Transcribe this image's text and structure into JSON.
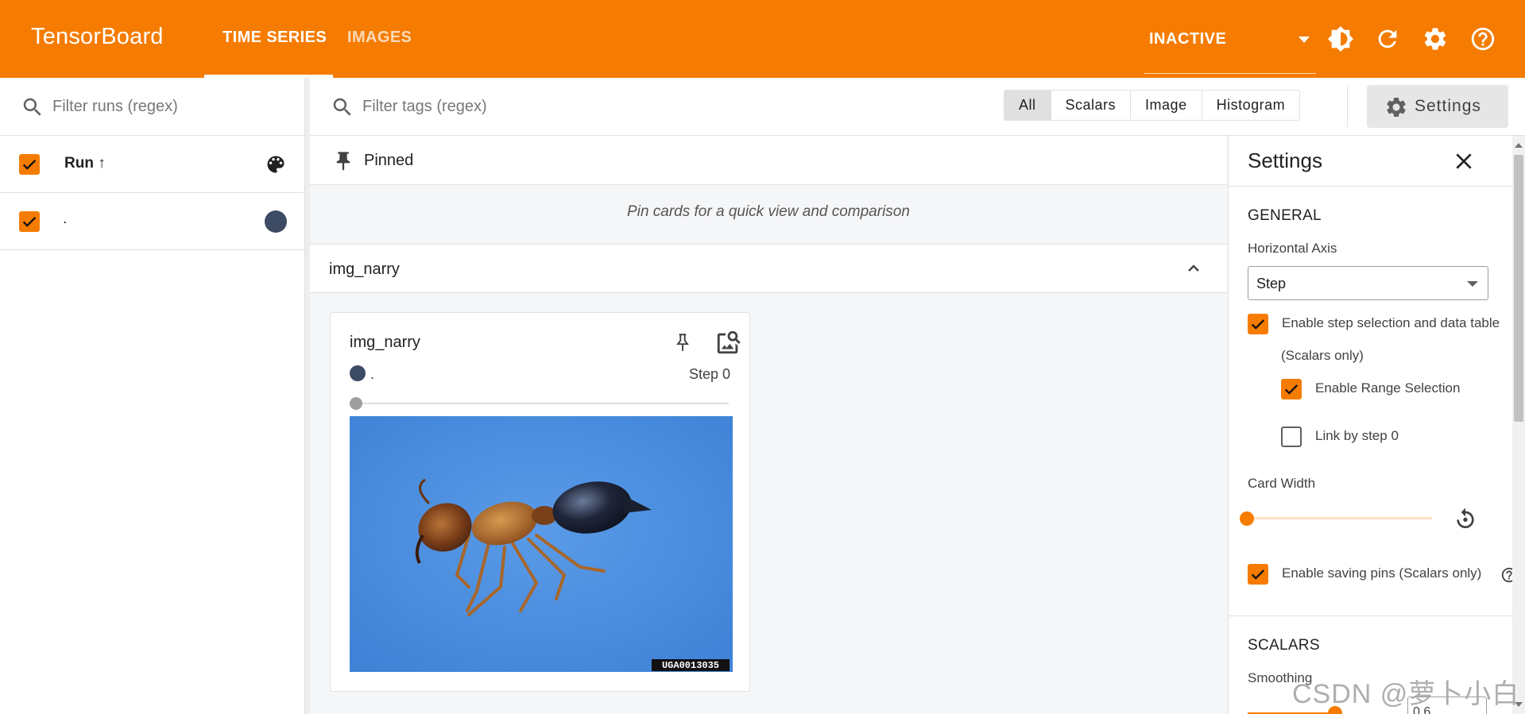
{
  "header": {
    "brand": "TensorBoard",
    "tabs": [
      {
        "label": "TIME SERIES",
        "active": true
      },
      {
        "label": "IMAGES",
        "active": false
      }
    ],
    "status": "INACTIVE",
    "icons": [
      "brightness-icon",
      "refresh-icon",
      "gear-icon",
      "help-icon"
    ],
    "bg_color": "#f57c00"
  },
  "sidebar": {
    "search_placeholder": "Filter runs (regex)",
    "header_label": "Run ↑",
    "runs": [
      {
        "label": ".",
        "checked": true,
        "color": "#3c4a63"
      }
    ]
  },
  "main": {
    "tag_search_placeholder": "Filter tags (regex)",
    "type_filters": [
      {
        "label": "All",
        "active": true
      },
      {
        "label": "Scalars",
        "active": false
      },
      {
        "label": "Image",
        "active": false
      },
      {
        "label": "Histogram",
        "active": false
      }
    ],
    "settings_button": "Settings",
    "pinned_label": "Pinned",
    "pin_hint": "Pin cards for a quick view and comparison",
    "group_label": "img_narry",
    "card": {
      "title": "img_narry",
      "run": ".",
      "step": "Step 0",
      "image_caption": "UGA0013035"
    }
  },
  "settings": {
    "title": "Settings",
    "general_title": "GENERAL",
    "horizontal_axis_label": "Horizontal Axis",
    "horizontal_axis_value": "Step",
    "enable_step_selection": "Enable step selection and data table",
    "scalars_only": "(Scalars only)",
    "enable_range_selection": "Enable Range Selection",
    "link_by_step": "Link by step 0",
    "card_width_label": "Card Width",
    "enable_saving_pins": "Enable saving pins (Scalars only)",
    "scalars_title": "SCALARS",
    "smoothing_label": "Smoothing",
    "smoothing_value": "0.6"
  },
  "watermark": "CSDN @萝卜小白"
}
